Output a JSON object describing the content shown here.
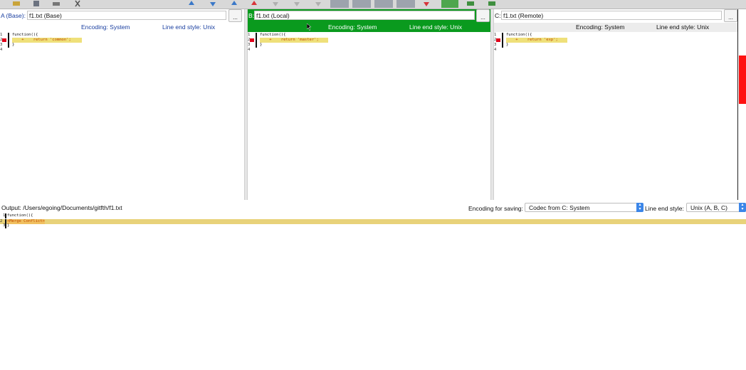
{
  "pane_a": {
    "label": "A (Base):",
    "file": "f1.txt (Base)",
    "encoding": "Encoding: System",
    "line_end": "Line end style: Unix",
    "code_lines": [
      "function(){",
      "    +    return 'common';",
      "}",
      ""
    ],
    "line_numbers": [
      "1",
      "2",
      "3",
      "4"
    ]
  },
  "pane_b": {
    "label": "B:",
    "file": "f1.txt (Local)",
    "encoding": "Encoding: System",
    "line_end": "Line end style: Unix",
    "code_lines": [
      "function(){",
      "    +    return 'master';",
      "}",
      ""
    ],
    "line_numbers": [
      "1",
      "2",
      "3",
      "4"
    ]
  },
  "pane_c": {
    "label": "C:",
    "file": "f1.txt (Remote)",
    "encoding": "Encoding: System",
    "line_end": "Line end style: Unix",
    "code_lines": [
      "function(){",
      "    +    return 'exp';",
      "}",
      ""
    ],
    "line_numbers": [
      "1",
      "2",
      "3",
      "4"
    ]
  },
  "dots_label": "...",
  "output": {
    "label": "Output:",
    "path": "/Users/egoing/Documents/gitfth/f1.txt",
    "encoding_label": "Encoding for saving:",
    "encoding_value": "Codec from C: System",
    "line_end_label": "Line end style:",
    "line_end_value": "Unix (A, B, C)",
    "code_lines": [
      "function(){",
      "<Merge Conflict>",
      "}"
    ],
    "line_numbers": [
      "1",
      "2",
      "3"
    ]
  },
  "colors": {
    "local_header": "#0a9a1e",
    "conflict_highlight": "#e8d27a",
    "diff_highlight": "#efe07a",
    "marker_red": "#e0001a",
    "select_accent": "#3c86e8"
  }
}
